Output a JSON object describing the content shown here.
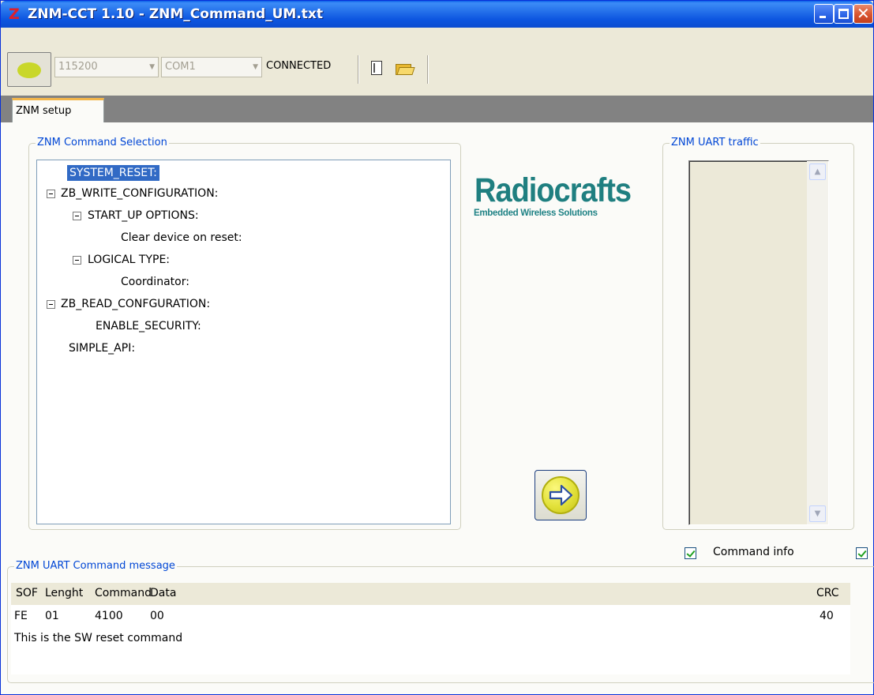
{
  "window": {
    "app_icon": "Z",
    "title": "ZNM-CCT 1.10 - ZNM_Command_UM.txt",
    "minimize_icon": "minimize-icon",
    "maximize_icon": "maximize-icon",
    "close_icon": "close-icon"
  },
  "toolbar": {
    "baud_rate": "115200",
    "com_port": "COM1",
    "connection_status": "CONNECTED",
    "led_color": "#c9d72a"
  },
  "tabs": [
    {
      "label": "ZNM setup",
      "active": true
    }
  ],
  "command_selection": {
    "legend": "ZNM Command Selection",
    "tree": [
      {
        "label": "SYSTEM_RESET:",
        "selected": true
      },
      {
        "label": "ZB_WRITE_CONFIGURATION:",
        "expanded": true
      },
      {
        "label": "START_UP OPTIONS:",
        "expanded": true
      },
      {
        "label": "Clear device on reset:"
      },
      {
        "label": "LOGICAL TYPE:",
        "expanded": true
      },
      {
        "label": "Coordinator:"
      },
      {
        "label": "ZB_READ_CONFGURATION:",
        "expanded": true
      },
      {
        "label": "ENABLE_SECURITY:"
      },
      {
        "label": "SIMPLE_API:"
      }
    ]
  },
  "logo": {
    "name": "Radiocrafts",
    "tagline": "Embedded Wireless Solutions",
    "color": "#1f7f80"
  },
  "uart_traffic": {
    "legend": "ZNM UART traffic"
  },
  "command_info": {
    "label": "Command info",
    "checked": true,
    "second_checked": true
  },
  "command_message": {
    "legend": "ZNM UART Command message",
    "headers": {
      "sof": "SOF",
      "length": "Lenght",
      "command": "Command",
      "data": "Data",
      "crc": "CRC"
    },
    "row": {
      "sof": "FE",
      "length": "01",
      "command": "4100",
      "data": "00",
      "crc": "40"
    },
    "description": "This is the SW reset command"
  }
}
